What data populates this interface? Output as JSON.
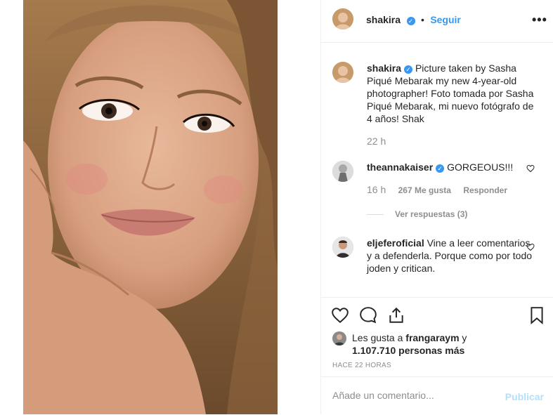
{
  "post": {
    "author": "shakira",
    "follow_label": "Seguir",
    "dot": "•",
    "more_label": "•••",
    "caption_author": "shakira",
    "caption_text": "Picture taken by Sasha Piqué Mebarak my new 4-year-old photographer! Foto tomada por Sasha Piqué Mebarak, mi nuevo fotógrafo de 4 años! Shak",
    "caption_time": "22 h"
  },
  "comments": [
    {
      "user": "theannakaiser",
      "text": "GORGEOUS!!!",
      "time": "16 h",
      "likes": "267 Me gusta",
      "reply_label": "Responder"
    },
    {
      "user": "eljeferoficial",
      "text": "Vine a leer comentarios y a defenderla. Porque como por todo joden y critican."
    }
  ],
  "replies_label": "Ver respuestas (3)",
  "likes": {
    "prefix": "Les gusta a ",
    "user": "frangaraym",
    "mid": " y",
    "count": "1.107.710 personas más"
  },
  "timestamp": "HACE 22 HORAS",
  "add_comment": {
    "placeholder": "Añade un comentario...",
    "publish_label": "Publicar"
  },
  "colors": {
    "accent": "#3897f0",
    "publish_disabled": "#b2dffc",
    "muted": "#8e8e8e"
  }
}
